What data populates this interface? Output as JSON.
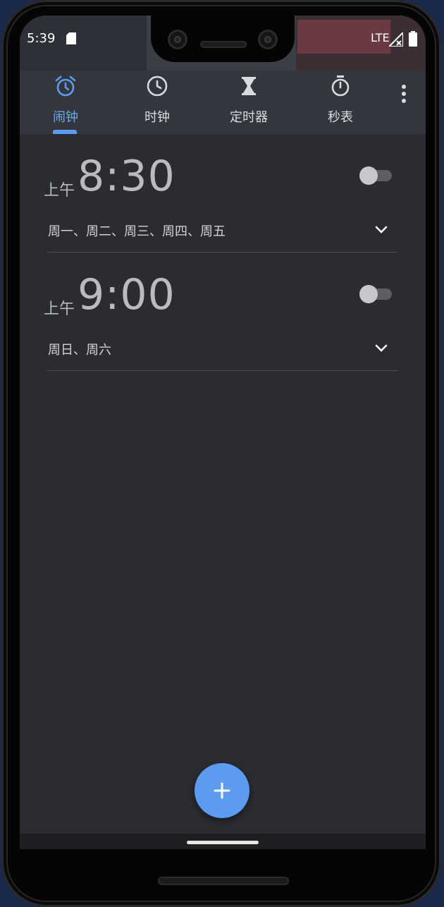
{
  "status_bar": {
    "time": "5:39",
    "network": "LTE",
    "icons": [
      "sd-card-icon",
      "signal-icon",
      "battery-icon"
    ]
  },
  "tabs": [
    {
      "label": "闹钟",
      "icon": "alarm-clock-icon",
      "active": true
    },
    {
      "label": "时钟",
      "icon": "clock-icon",
      "active": false
    },
    {
      "label": "定时器",
      "icon": "hourglass-icon",
      "active": false
    },
    {
      "label": "秒表",
      "icon": "stopwatch-icon",
      "active": false
    }
  ],
  "alarms": [
    {
      "ampm": "上午",
      "time": "8:30",
      "days": "周一、周二、周三、周四、周五",
      "enabled": false
    },
    {
      "ampm": "上午",
      "time": "9:00",
      "days": "周日、周六",
      "enabled": false
    }
  ],
  "colors": {
    "accent": "#5b9cf2",
    "background": "#2a2c31",
    "tabbar": "#33363d",
    "text_muted": "#b9bbbe"
  },
  "fab": {
    "icon": "plus-icon"
  }
}
